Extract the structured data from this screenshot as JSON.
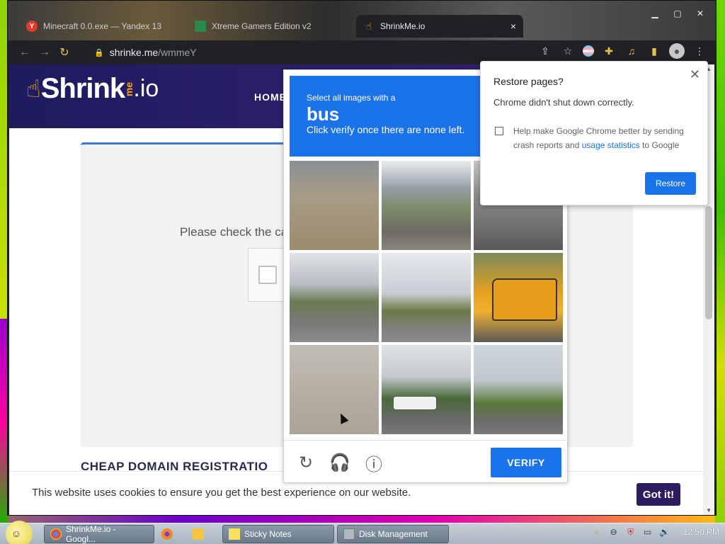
{
  "browser": {
    "tabs": [
      {
        "label": "Minecraft 0.0.exe — Yandex 13",
        "favicon": "yandex-icon"
      },
      {
        "label": "Xtreme Gamers Edition v2",
        "favicon": "app-icon"
      },
      {
        "label": "ShrinkMe.io",
        "favicon": "shrinkme-icon",
        "close": "×"
      }
    ],
    "url_host": "shrinke.me",
    "url_path": "/wmmeY"
  },
  "site": {
    "logo_text": "Shrink",
    "logo_me": "me",
    "logo_io": ".io",
    "nav_home": "HOME",
    "please_check": "Please check the ca",
    "section_heading": "CHEAP DOMAIN REGISTRATIO",
    "cookie_text": "This website uses cookies to ensure you get the best experience on our website.",
    "cookie_button": "Got it!"
  },
  "captcha": {
    "instruction_prefix": "Select all images with a",
    "target": "bus",
    "instruction_suffix": "Click verify once there are none left.",
    "verify_label": "VERIFY",
    "tiles": [
      "tile-1",
      "tile-2",
      "tile-3",
      "tile-4",
      "tile-5",
      "tile-6",
      "tile-7",
      "tile-8",
      "tile-9"
    ]
  },
  "restore": {
    "title": "Restore pages?",
    "message": "Chrome didn't shut down correctly.",
    "help_prefix": "Help make Google Chrome better by sending crash reports and ",
    "help_link": "usage statistics",
    "help_suffix": " to Google",
    "button": "Restore"
  },
  "taskbar": {
    "items": [
      {
        "label": "ShrinkMe.io - Googl..."
      },
      {
        "label": "Sticky Notes"
      },
      {
        "label": "Disk Management"
      }
    ],
    "clock": "12:50 PM"
  },
  "colors": {
    "accent_blue": "#1a73e8",
    "header_purple": "#1e1b5e",
    "cookie_button": "#2c1e5e"
  }
}
